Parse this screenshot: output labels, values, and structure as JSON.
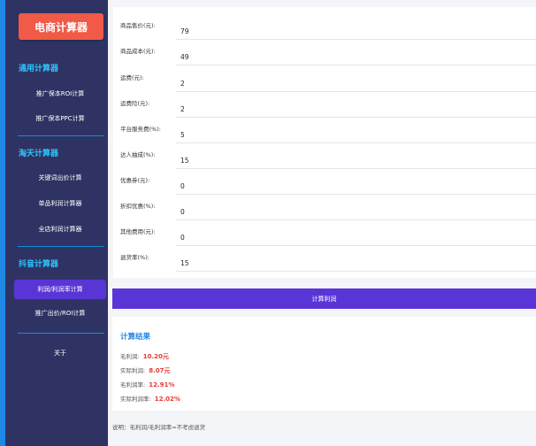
{
  "app": {
    "logo_label": "电商计算器"
  },
  "sidebar": {
    "sections": [
      {
        "title": "通用计算器",
        "items": [
          "推广保本ROI计算",
          "推广保本PPC计算"
        ]
      },
      {
        "title": "淘天计算器",
        "items": [
          "关键词出价计算",
          "单品利润计算器",
          "全店利润计算器"
        ]
      },
      {
        "title": "抖音计算器",
        "items": [
          "利润/利润率计算",
          "推广出价/ROI计算"
        ]
      }
    ],
    "about_label": "关于",
    "active_item": "利润/利润率计算"
  },
  "form": {
    "fields": [
      {
        "label": "商品售价(元):",
        "value": "79"
      },
      {
        "label": "商品成本(元):",
        "value": "49"
      },
      {
        "label": "运费(元):",
        "value": "2"
      },
      {
        "label": "运费险(元):",
        "value": "2"
      },
      {
        "label": "平台服务费(%):",
        "value": "5"
      },
      {
        "label": "达人抽成(%):",
        "value": "15"
      },
      {
        "label": "优惠券(元):",
        "value": "0"
      },
      {
        "label": "折扣优惠(%):",
        "value": "0"
      },
      {
        "label": "其他费用(元):",
        "value": "0"
      },
      {
        "label": "退货率(%):",
        "value": "15"
      }
    ],
    "submit_label": "计算利润"
  },
  "result": {
    "title": "计算结果",
    "lines": [
      {
        "label": "毛利润:",
        "value": "10.20元"
      },
      {
        "label": "实际利润:",
        "value": "8.07元"
      },
      {
        "label": "毛利润率:",
        "value": "12.91%"
      },
      {
        "label": "实际利润率:",
        "value": "12.02%"
      }
    ]
  },
  "note": "说明：毛利润/毛利润率=不考虑退货",
  "colors": {
    "sidebar_bg": "#2f3363",
    "accent_blue": "#1e88e5",
    "section_title": "#2ec6ff",
    "logo_red": "#f05a47",
    "primary_purple": "#5a35d6",
    "value_red": "#e53935"
  }
}
